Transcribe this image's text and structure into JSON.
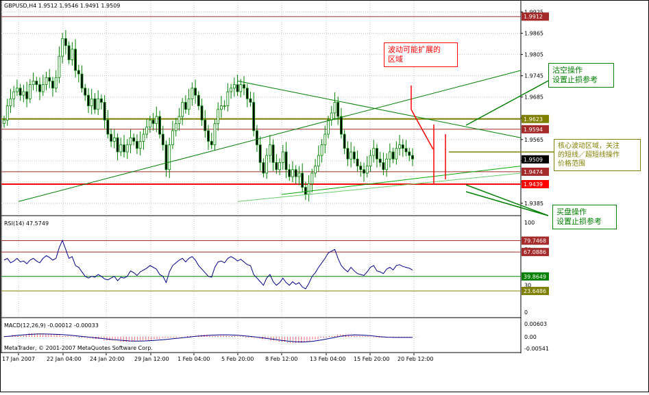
{
  "chart_data": [
    {
      "type": "candlestick",
      "title": "GBPUSD,H4  1.9512 1.9546 1.9491 1.9509",
      "symbol": "GBPUSD",
      "timeframe": "H4",
      "last_bar": {
        "open": 1.9512,
        "high": 1.9546,
        "low": 1.9491,
        "close": 1.9509
      },
      "ylim": [
        1.9352,
        1.9955
      ],
      "y_ticks": [
        1.9925,
        1.9865,
        1.9805,
        1.9745,
        1.9685,
        1.9625,
        1.9565,
        1.9505,
        1.9445,
        1.9385
      ],
      "x_tick_labels": [
        "17 Jan 2007",
        "22 Jan 04:00",
        "24 Jan 20:00",
        "29 Jan 12:00",
        "1 Feb 04:00",
        "5 Feb 20:00",
        "8 Feb 12:00",
        "13 Feb 04:00",
        "15 Feb 20:00",
        "20 Feb 12:00"
      ],
      "price_levels": [
        {
          "value": 1.9912,
          "label": "1.9912",
          "color": "#a52a2a"
        },
        {
          "value": 1.9623,
          "label": "1.9623",
          "color": "#808000"
        },
        {
          "value": 1.9594,
          "label": "1.9594",
          "color": "#a52a2a"
        },
        {
          "value": 1.9474,
          "label": "1.9474",
          "color": "#a52a2a"
        },
        {
          "value": 1.9439,
          "label": "1.9439",
          "color": "#ff0000"
        }
      ],
      "current_price": "1.9509",
      "close_series": [
        1.962,
        1.966,
        1.968,
        1.97,
        1.971,
        1.969,
        1.97,
        1.968,
        1.972,
        1.973,
        1.972,
        1.97,
        1.972,
        1.974,
        1.973,
        1.971,
        1.974,
        1.98,
        1.985,
        1.983,
        1.979,
        1.982,
        1.976,
        1.975,
        1.971,
        1.969,
        1.966,
        1.968,
        1.965,
        1.968,
        1.967,
        1.962,
        1.958,
        1.956,
        1.957,
        1.953,
        1.955,
        1.953,
        1.955,
        1.957,
        1.956,
        1.954,
        1.956,
        1.958,
        1.96,
        1.962,
        1.961,
        1.963,
        1.958,
        1.955,
        1.948,
        1.955,
        1.959,
        1.961,
        1.963,
        1.967,
        1.965,
        1.968,
        1.971,
        1.969,
        1.966,
        1.962,
        1.959,
        1.956,
        1.955,
        1.961,
        1.965,
        1.966,
        1.966,
        1.97,
        1.971,
        1.972,
        1.97,
        1.972,
        1.971,
        1.968,
        1.967,
        1.959,
        1.955,
        1.95,
        1.947,
        1.952,
        1.955,
        1.95,
        1.948,
        1.95,
        1.953,
        1.948,
        1.946,
        1.948,
        1.946,
        1.947,
        1.943,
        1.941,
        1.944,
        1.947,
        1.949,
        1.952,
        1.955,
        1.958,
        1.962,
        1.964,
        1.967,
        1.963,
        1.958,
        1.954,
        1.951,
        1.953,
        1.951,
        1.949,
        1.948,
        1.947,
        1.949,
        1.952,
        1.954,
        1.951,
        1.95,
        1.948,
        1.951,
        1.953,
        1.951,
        1.954,
        1.955,
        1.954,
        1.953,
        1.952,
        1.951
      ],
      "trendlines": [
        {
          "name": "upper-channel-green",
          "from": [
            "17 Jan 2007",
            1.939
          ],
          "to": [
            "20 Feb 12:00+",
            1.976
          ],
          "color": "#008000"
        },
        {
          "name": "triangle-upper",
          "from": [
            "5 Feb 20:00",
            1.973
          ],
          "to": [
            "20 Feb 12:00+",
            1.957
          ],
          "color": "#008000"
        },
        {
          "name": "triangle-lower",
          "from": [
            "8 Feb 12:00",
            1.941
          ],
          "to": [
            "20 Feb 12:00+",
            1.949
          ],
          "color": "#00aa00"
        },
        {
          "name": "support-lightgreen",
          "from": [
            "5 Feb 20:00",
            1.939
          ],
          "to": [
            "20 Feb 12:00+",
            1.947
          ],
          "color": "#66cc66"
        }
      ],
      "annotations": [
        {
          "text": "波动可能扩展的\n区域",
          "color": "#ff0000"
        },
        {
          "text": "沽空操作\n设置止损参考",
          "color": "#008000"
        },
        {
          "text": "核心波动区域，关注\n的短线／超短线操作\n价格范围",
          "color": "#808000"
        },
        {
          "text": "买盘操作\n设置止损参考",
          "color": "#008000"
        }
      ]
    },
    {
      "type": "line",
      "title": "RSI(14) 47.5749",
      "ylim": [
        0,
        100
      ],
      "y_ticks": [
        100,
        70,
        30,
        0
      ],
      "levels": [
        {
          "value": 79.7468,
          "label": "79.7468",
          "color": "#a52a2a"
        },
        {
          "value": 67.0886,
          "label": "67.0886",
          "color": "#a52a2a"
        },
        {
          "value": 39.8649,
          "label": "39.8649",
          "color": "#008000"
        },
        {
          "value": 23.6486,
          "label": "23.6486",
          "color": "#808000"
        }
      ],
      "series": [
        {
          "name": "RSI(14)",
          "values": [
            58,
            60,
            55,
            57,
            60,
            56,
            57,
            54,
            58,
            60,
            57,
            55,
            60,
            63,
            61,
            58,
            60,
            72,
            80,
            70,
            60,
            62,
            52,
            50,
            45,
            40,
            38,
            40,
            39,
            42,
            40,
            37,
            36,
            38,
            40,
            35,
            39,
            38,
            40,
            46,
            44,
            41,
            45,
            47,
            49,
            52,
            50,
            48,
            42,
            40,
            33,
            45,
            52,
            55,
            58,
            60,
            56,
            60,
            62,
            58,
            52,
            48,
            44,
            40,
            39,
            50,
            56,
            57,
            55,
            60,
            62,
            60,
            57,
            59,
            56,
            53,
            52,
            42,
            38,
            34,
            30,
            38,
            42,
            34,
            30,
            33,
            38,
            33,
            30,
            34,
            31,
            33,
            28,
            26,
            32,
            40,
            44,
            50,
            55,
            60,
            66,
            68,
            70,
            60,
            52,
            48,
            45,
            50,
            46,
            43,
            42,
            41,
            45,
            50,
            52,
            46,
            45,
            43,
            48,
            50,
            47,
            52,
            53,
            51,
            50,
            49,
            47
          ]
        }
      ]
    },
    {
      "type": "bar",
      "title": "MACD(12,26,9) -0.00012 -0.00033",
      "ylim": [
        -0.00541,
        0.00603
      ],
      "y_ticks": [
        0.00603,
        0.0,
        -0.00541
      ],
      "y_tick_labels": [
        "0.00603",
        "0.00",
        "-0.00541"
      ],
      "series": [
        {
          "name": "MACD",
          "values": [
            0.0003,
            0.0008,
            0.0012,
            0.0015,
            0.0016,
            0.0014,
            0.001,
            0.0006,
            0.0002,
            -0.0004,
            -0.0008,
            -0.0012,
            -0.0016,
            -0.002,
            -0.0022,
            -0.0023,
            -0.0021,
            -0.0017,
            -0.0012,
            -0.0007,
            -0.0003,
            0.0001,
            0.0005,
            0.0008,
            0.001,
            0.0011,
            0.0009,
            0.0006,
            0.0002,
            -0.0003,
            -0.0008,
            -0.0014,
            -0.002,
            -0.0025,
            -0.0028,
            -0.0027,
            -0.0022,
            -0.0014,
            -0.0004,
            0.0006,
            0.0012,
            0.0014,
            0.001,
            0.0004,
            -0.0002,
            -0.0005,
            -0.0006,
            -0.0004,
            -0.0002,
            -0.0001
          ]
        },
        {
          "name": "Signal",
          "values": [
            0.0001,
            0.0004,
            0.0008,
            0.0011,
            0.0013,
            0.0013,
            0.0012,
            0.001,
            0.0007,
            0.0003,
            -0.0001,
            -0.0005,
            -0.0009,
            -0.0013,
            -0.0016,
            -0.0019,
            -0.002,
            -0.0019,
            -0.0017,
            -0.0014,
            -0.001,
            -0.0006,
            -0.0002,
            0.0002,
            0.0005,
            0.0008,
            0.0009,
            0.0009,
            0.0007,
            0.0004,
            0.0,
            -0.0005,
            -0.001,
            -0.0015,
            -0.002,
            -0.0023,
            -0.0024,
            -0.0021,
            -0.0015,
            -0.0008,
            0.0,
            0.0006,
            0.0009,
            0.0008,
            0.0005,
            0.0001,
            -0.0002,
            -0.0003,
            -0.0003,
            -0.0003
          ]
        }
      ]
    }
  ],
  "footer": {
    "copyright": "MetaTrader, © 2001-2007 MetaQuotes Software Corp."
  },
  "colors": {
    "bull": "#008000",
    "bear": "#008000",
    "grid": "#c0c0c0",
    "axis": "#000000",
    "rsi": "#00008b",
    "macd_hist": "#ff0000"
  }
}
